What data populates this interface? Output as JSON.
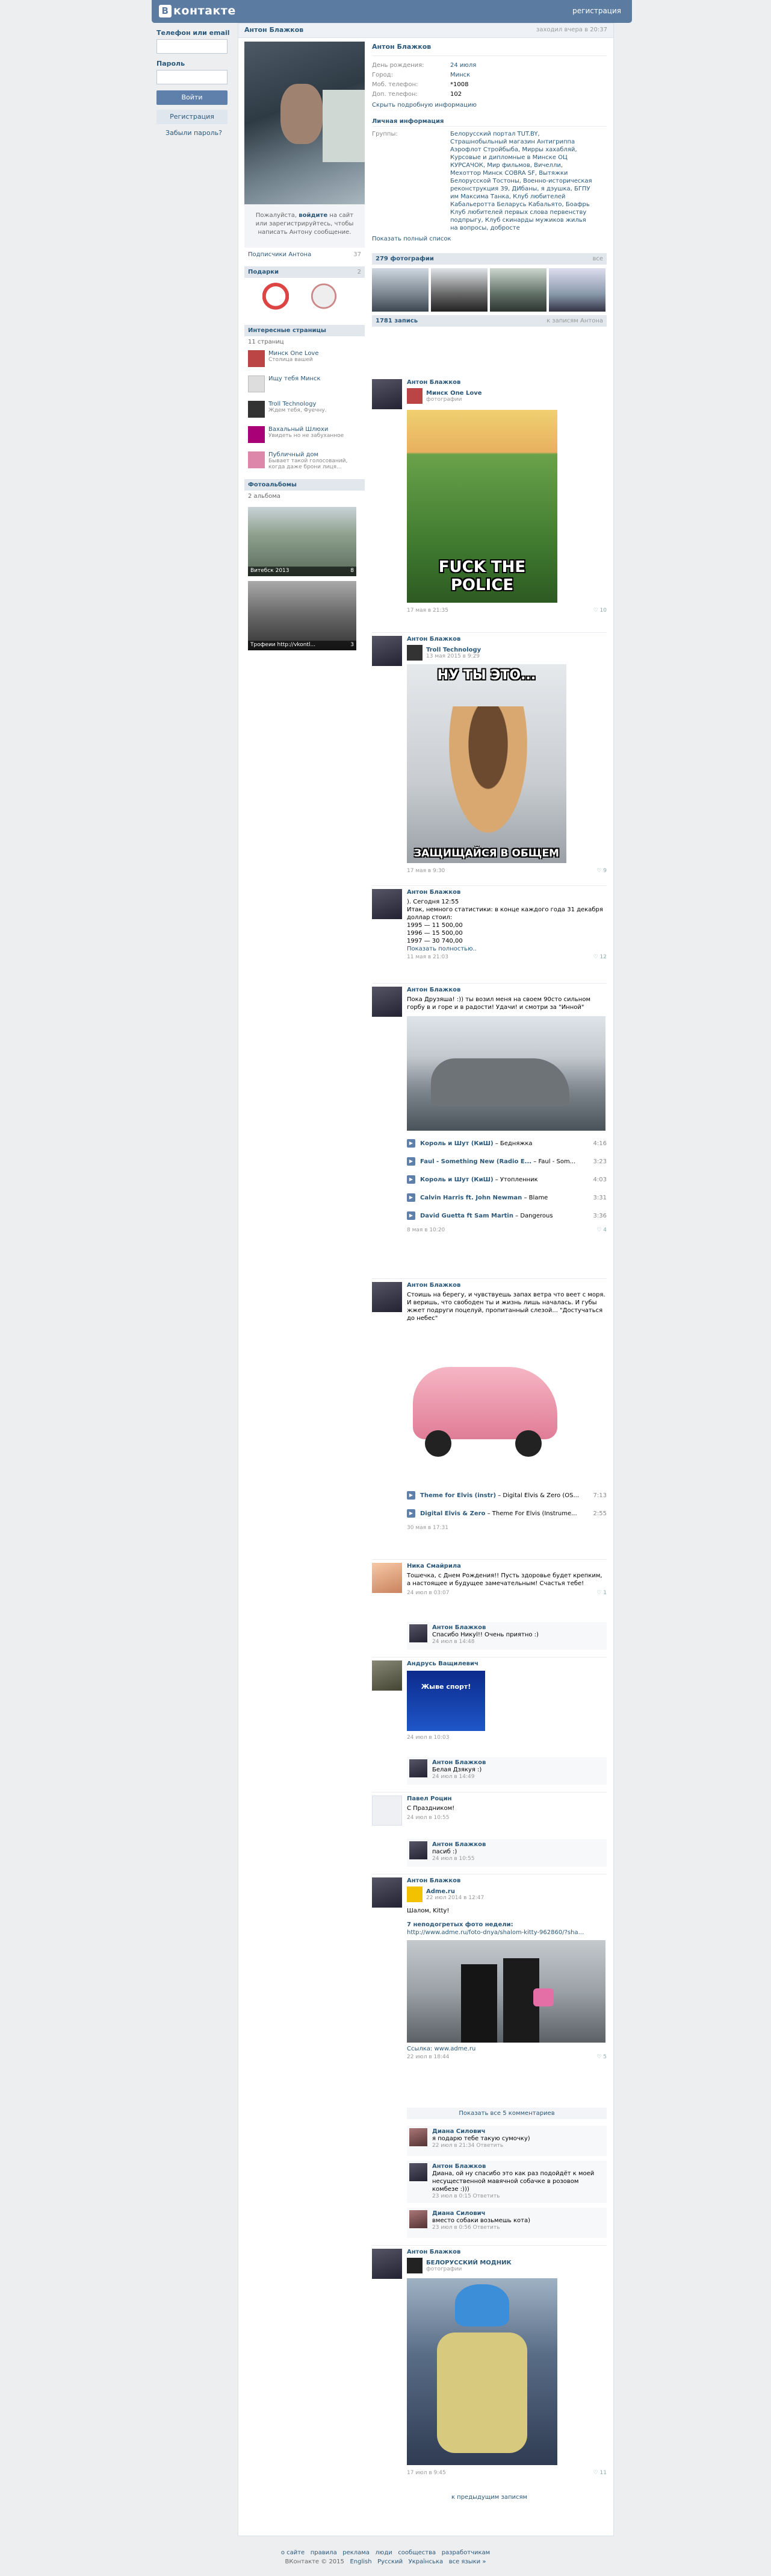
{
  "header": {
    "logo_letter": "В",
    "logo_text": "контакте",
    "register_link": "регистрация"
  },
  "login": {
    "phone_label": "Телефон или email",
    "password_label": "Пароль",
    "login_button": "Войти",
    "register_button": "Регистрация",
    "forgot_link": "Забыли пароль?"
  },
  "profile": {
    "title_name": "Антон Блажков",
    "online_status": "заходил вчера в 20:37",
    "name": "Антон Блажков",
    "message_prompt_1": "Пожалуйста,",
    "message_prompt_login": "войдите",
    "message_prompt_2": "на сайт или зарегистрируйтесь, чтобы написать Антону сообщение.",
    "subscribers_label": "Подписчики Антона",
    "subscribers_count": "37",
    "info": [
      {
        "k": "День рождения:",
        "v": "24 июля"
      },
      {
        "k": "Город:",
        "v": "Минск"
      },
      {
        "k": "Моб. телефон:",
        "v": "*1008"
      },
      {
        "k": "Доп. телефон:",
        "v": "102"
      }
    ],
    "hide_info": "Скрыть подробную информацию",
    "personal_header": "Личная информация",
    "groups_label": "Группы:",
    "groups_text": "Белорусский портал TUT.BY, Страшнобыльный магазин Антигриппа Аэрофлот Стройбыба, Мирры хахабляй, Курсовые и дипломные в Минске ОЦ КУРСАЧОК, Мир фильмов, Вичелли, Мехоттор Минск COBRA SF, Вытяжки Белорусской Тостоны, Военно-историческая реконструкция 39, ДИбаны, я дэушка, БГПУ им Максима Танка, Клуб любителей Кабальеротта Беларусь Кабальято, Боафрь Клуб любителей первых слова первенству подпрыгу, Клуб скинарды мужиков жилья на вопросы, добросте",
    "show_full": "Показать полный список"
  },
  "gifts": {
    "header": "Подарки",
    "count": "2"
  },
  "pages": {
    "header": "Интересные страницы",
    "sub": "11 страниц",
    "items": [
      {
        "name": "Минск One Love",
        "desc": "Столица вашей"
      },
      {
        "name": "Ищу тебя Минск",
        "desc": ""
      },
      {
        "name": "Troll Technology",
        "desc": "Ждем тебя, Фуечну."
      },
      {
        "name": "Вахальный Шлюхи",
        "desc": "Увидеть но не забуханное"
      },
      {
        "name": "Публичный дом",
        "desc": "Бывает такой голосований, когда даже брони лиця..."
      }
    ]
  },
  "albums": {
    "header": "Фотоальбомы",
    "sub": "2 альбома",
    "items": [
      {
        "caption": "Витебск 2013",
        "count": "8"
      },
      {
        "caption": "Трофеии http://vkontl...",
        "count": "3"
      }
    ]
  },
  "photos": {
    "header": "279 фотографии",
    "right": "все"
  },
  "wall": {
    "header": "1781 запись",
    "right": "к записям Антона",
    "prev": "к предыдущим записям"
  },
  "posts": [
    {
      "author": "Антон Блажков",
      "repost_name": "Минск One Love",
      "repost_sub": "фотографии",
      "caption": "FUCK THE POLICE",
      "date": "17 мая в 21:35",
      "likes": "10"
    },
    {
      "author": "Антон Блажков",
      "repost_name": "Troll Technology",
      "repost_sub": "13 мая 2015 в 9:29",
      "caption_top": "НУ ТЫ ЭТО...",
      "caption_bottom": "ЗАЩИЩАЙСЯ В ОБЩЕМ",
      "date": "17 мая в 9:30",
      "likes": "9"
    },
    {
      "author": "Антон Блажков",
      "lines": [
        "). Сегодня 12:55",
        "Итак, немного статистики: в конце каждого года 31 декабря доллар стоил:",
        "1995 — 11 500,00",
        "1996 — 15 500,00",
        "1997 — 30 740,00"
      ],
      "more": "Показать полностью..",
      "date": "11 мая в 21:03",
      "likes": "12"
    },
    {
      "author": "Антон Блажков",
      "text": "Пока Друзяша! :)) ты возил меня на своем 90сто сильном горбу в и горе и в радости! Удачи! и смотри за \"Инной\"",
      "date": "8 мая в 10:20",
      "likes": "4",
      "audio": [
        {
          "artist": "Король и Шут (КиШ)",
          "title": "Бедняжка",
          "dur": "4:16"
        },
        {
          "artist": "Faul - Something New (Radio E...",
          "title": "Faul - Som...",
          "dur": "3:23"
        },
        {
          "artist": "Король и Шут (КиШ)",
          "title": "Утопленник",
          "dur": "4:03"
        },
        {
          "artist": "Calvin Harris ft. John Newman",
          "title": "Blame",
          "dur": "3:31"
        },
        {
          "artist": "David Guetta ft Sam Martin",
          "title": "Dangerous",
          "dur": "3:36"
        }
      ]
    },
    {
      "author": "Антон Блажков",
      "text": "Стоишь на берегу, и чувствуешь запах ветра что веет с моря. И веришь, что свободен ты и жизнь лишь началась. И губы жжет подруги поцелуй, пропитанный слезой... \"Достучаться до небес\"",
      "date": "30 мая в 17:31",
      "likes": "",
      "audio": [
        {
          "artist": "Theme for Elvis (instr)",
          "title": "Digital Elvis & Zero (OS...",
          "dur": "7:13"
        },
        {
          "artist": "Digital Elvis & Zero",
          "title": "Theme For Elvis (Instrume...",
          "dur": "2:55"
        }
      ]
    },
    {
      "author": "Ника Смайрила",
      "text": "Тошечка, с Днем Рождения!! Пусть здоровье будет крепким, а настоящее и будущее замечательным! Счастья тебе!",
      "date": "24 июл в 03:07",
      "likes": "1",
      "comment": {
        "author": "Антон Блажков",
        "text": "Спасибо Никуl!! Очень приятно :)",
        "date": "24 июл в 14:48"
      }
    },
    {
      "author": "Андрусь Ващилевич",
      "img_text": "Жыве спорт!",
      "date": "24 июл в 10:03",
      "likes": "",
      "comment": {
        "author": "Антон Блажков",
        "text": "Белая Дзякуя :)",
        "date": "24 июл в 14:49"
      }
    },
    {
      "author": "Павел Роцин",
      "text": "С Праздником!",
      "date": "24 июл в 10:55",
      "likes": "",
      "comment": {
        "author": "Антон Блажков",
        "text": "пасиб :)",
        "date": "24 июл в 10:55"
      }
    },
    {
      "author": "Антон Блажков",
      "repost_name": "Adme.ru",
      "repost_sub": "22 июл 2014 в 12:47",
      "text": "Шалом, Kitty!",
      "sub_title": "7 неподогретых фото недели:",
      "link": "http://www.adme.ru/foto-dnya/shalom-kitty-962860/?sha...",
      "source": "Ссылка: www.adme.ru",
      "date": "22 июл в 18:44",
      "likes": "5",
      "show_all": "Показать все 5 комментариев",
      "comments": [
        {
          "author": "Диана Силович",
          "text": "я подарю тебе такую сумочку)",
          "date": "22 июл в 21:34 Ответить"
        },
        {
          "author": "Антон Блажков",
          "text": "Диана, ой ну спасибо это как раз подойдёт к моей несущественной мавячной собачке в розовом комбезе :)))",
          "date": "23 июл в 0:15 Ответить"
        },
        {
          "author": "Диана Силович",
          "text": "вместо собаки возьмешь кота)",
          "date": "23 июл в 0:56 Ответить"
        }
      ]
    },
    {
      "author": "Антон Блажков",
      "repost_name": "БЕЛОРУССКИЙ МОДНИК",
      "repost_sub": "фотографии",
      "date": "17 июл в 9:45",
      "likes": "11"
    }
  ],
  "footer": {
    "links": [
      "о сайте",
      "правила",
      "реклама",
      "люди",
      "сообщества",
      "разработчикам"
    ],
    "copyright": "ВКонтакте © 2015",
    "langs": [
      "English",
      "Русский",
      "Українська",
      "все языки »"
    ]
  }
}
